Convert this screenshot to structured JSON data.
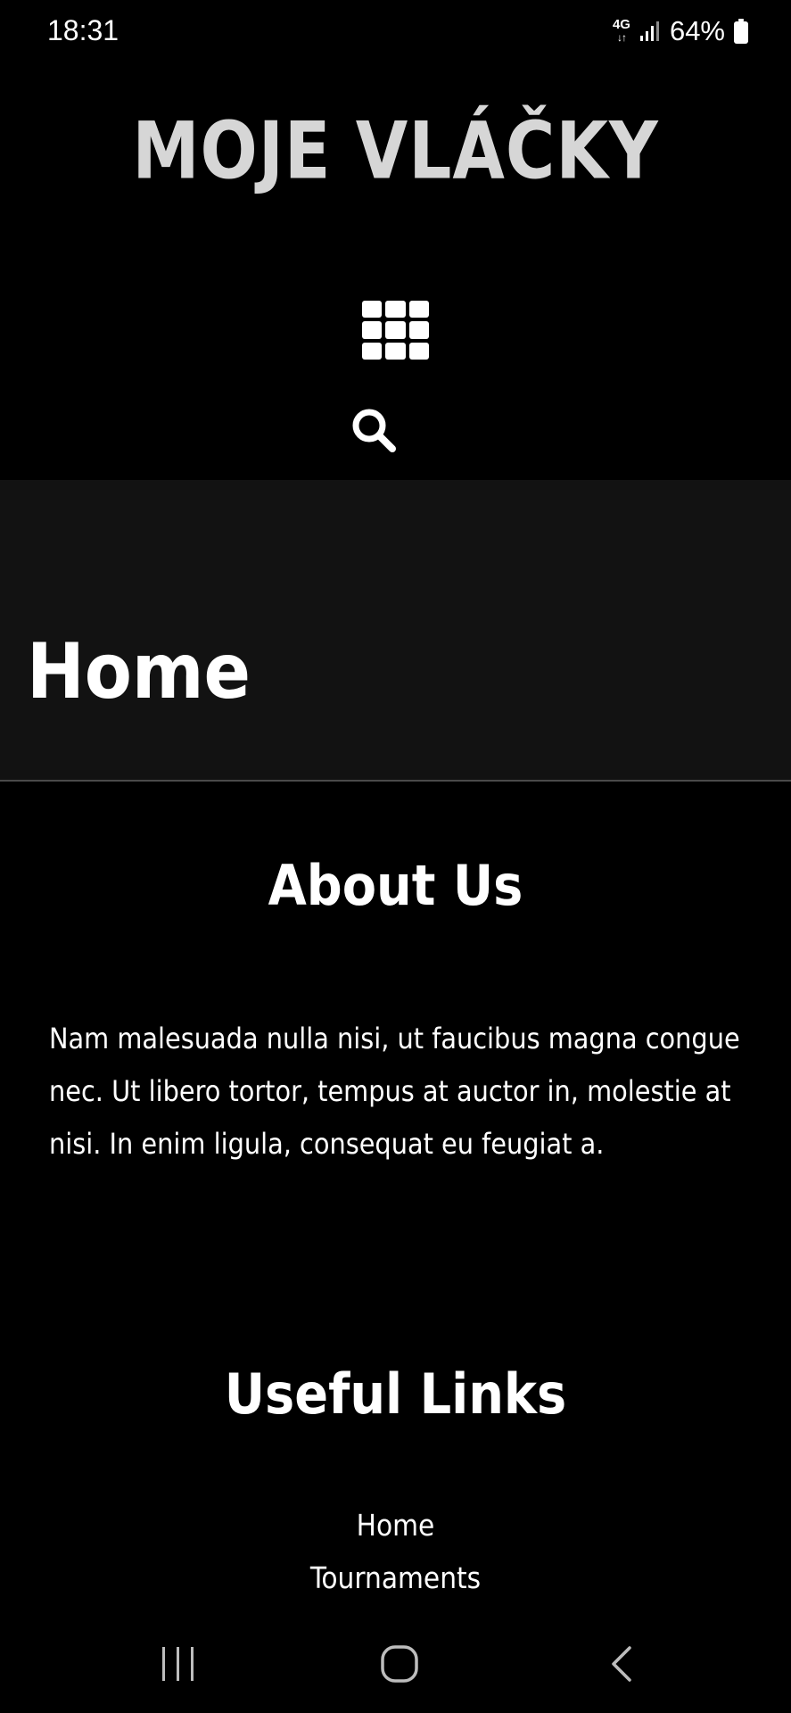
{
  "status_bar": {
    "time": "18:31",
    "network": "4G",
    "battery": "64%"
  },
  "header": {
    "site_title": "MOJE VLÁČKY",
    "menu_icon": "grid-menu-icon",
    "search_icon": "search-icon"
  },
  "hero": {
    "title": "Home"
  },
  "about": {
    "title": "About Us",
    "text": "Nam malesuada nulla nisi, ut faucibus magna congue nec. Ut libero tortor, tempus at auctor in, molestie at nisi. In enim ligula, consequat eu feugiat a."
  },
  "useful_links": {
    "title": "Useful Links",
    "items": [
      {
        "label": "Home"
      },
      {
        "label": "Tournaments"
      }
    ]
  },
  "nav_bar": {
    "recents_icon": "recents-icon",
    "home_icon": "home-circle-icon",
    "back_icon": "back-chevron-icon"
  },
  "colors": {
    "background": "#000000",
    "hero_background": "#121212",
    "title_gray": "#d6d6d6",
    "text": "#ffffff"
  }
}
